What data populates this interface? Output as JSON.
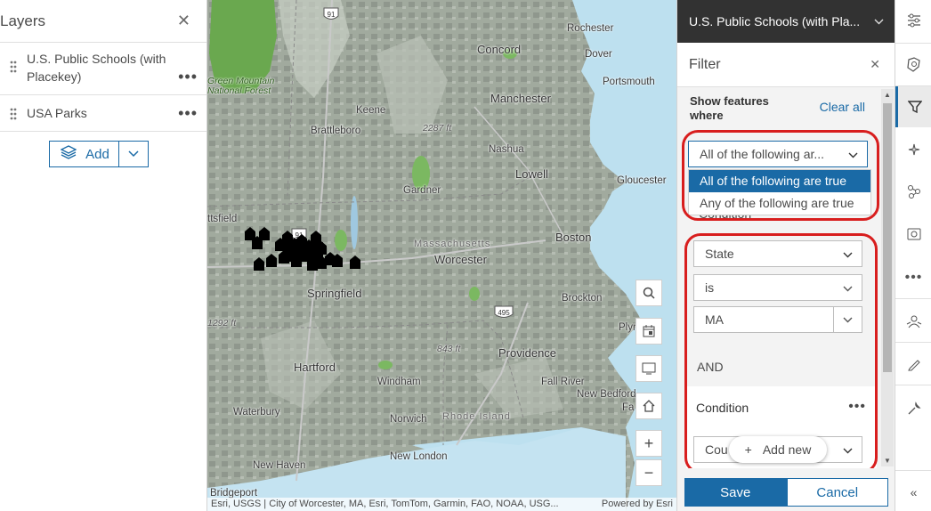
{
  "layers_panel": {
    "title": "Layers",
    "items": [
      {
        "label": "U.S. Public Schools (with Placekey)"
      },
      {
        "label": "USA Parks"
      }
    ],
    "add_label": "Add"
  },
  "map": {
    "places": {
      "concord": "Concord",
      "rochester": "Rochester",
      "dover": "Dover",
      "portsmouth": "Portsmouth",
      "green_mountain": "Green Mountain\nNational Forest",
      "manchester": "Manchester",
      "keene": "Keene",
      "brattleboro": "Brattleboro",
      "nashua": "Nashua",
      "lowell": "Lowell",
      "gloucester": "Gloucester",
      "gardner": "Gardner",
      "pittsfield": "ttsfield",
      "massachusetts": "Massachusetts",
      "boston": "Boston",
      "worcester": "Worcester",
      "springfield": "Springfield",
      "brockton": "Brockton",
      "providence": "Providence",
      "hartford": "Hartford",
      "windham": "Windham",
      "fall_river": "Fall River",
      "new_bedford": "New Bedford",
      "waterbury": "Waterbury",
      "norwich": "Norwich",
      "rhode_island": "Rhode Island",
      "new_haven": "New Haven",
      "new_london": "New London",
      "bridgeport": "Bridgeport",
      "plym": "Plym",
      "fa": "Fa"
    },
    "elevations": {
      "e1": "2287 ft",
      "e2": "1292 ft",
      "e3": "843 ft"
    },
    "route_labels": {
      "r91a": "91",
      "r91b": "91",
      "r495": "495"
    },
    "attribution": "Esri, USGS | City of Worcester, MA, Esri, TomTom, Garmin, FAO, NOAA, USG...",
    "powered_by": "Powered by Esri"
  },
  "filter_panel": {
    "layer_title": "U.S. Public Schools (with Pla...",
    "title": "Filter",
    "show_features_label": "Show features where",
    "clear_all": "Clear all",
    "match_select_value": "All of the following ar...",
    "match_options": [
      "All of the following are true",
      "Any of the following are true"
    ],
    "partial_label": "Condition",
    "condition1": {
      "field": "State",
      "operator": "is",
      "value": "MA"
    },
    "join_word": "AND",
    "condition2_title": "Condition",
    "condition2_field_partial": "Cou",
    "add_new_label": "Add new",
    "save_label": "Save",
    "cancel_label": "Cancel"
  },
  "toolbar": {
    "tools": [
      "properties-icon",
      "styles-icon",
      "filter-icon",
      "effects-icon",
      "analysis-icon",
      "configure-popups-icon",
      "more-icon",
      "sketch-icon",
      "edit-icon",
      "settings-icon",
      "collapse-icon"
    ]
  },
  "colors": {
    "accent": "#1a6aa6",
    "annotation_red": "#d81e1e",
    "topbar": "#323232"
  }
}
